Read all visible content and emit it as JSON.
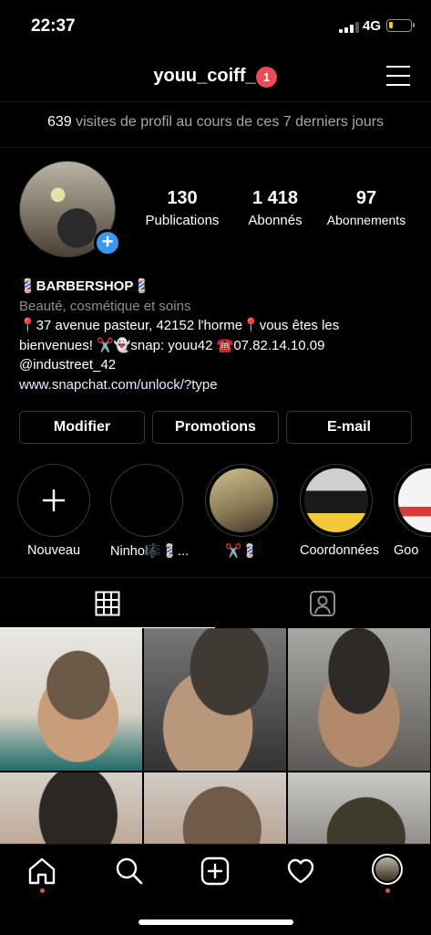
{
  "status_bar": {
    "time": "22:37",
    "network": "4G"
  },
  "header": {
    "username": "youu_coiff_",
    "notification_count": "1"
  },
  "visits": {
    "count": "639",
    "text": "visites de profil au cours de ces 7 derniers jours"
  },
  "stats": [
    {
      "value": "130",
      "label": "Publications"
    },
    {
      "value": "1 418",
      "label": "Abonnés"
    },
    {
      "value": "97",
      "label": "Abonnements"
    }
  ],
  "bio": {
    "name": "💈BARBERSHOP💈",
    "category": "Beauté, cosmétique et soins",
    "line1": "📍37 avenue pasteur, 42152 l'horme📍vous êtes les",
    "line2": "bienvenues! ✂️👻snap: youu42 ☎️07.82.14.10.09",
    "line3": "@industreet_42",
    "link": "www.snapchat.com/unlock/?type"
  },
  "buttons": {
    "edit": "Modifier",
    "promotions": "Promotions",
    "email": "E-mail"
  },
  "highlights": [
    {
      "label": "Nouveau"
    },
    {
      "label": "Ninho🎼💈..."
    },
    {
      "label": "✂️💈"
    },
    {
      "label": "Coordonnées"
    },
    {
      "label": "Goo"
    }
  ],
  "colors": {
    "accent_blue": "#3897f0",
    "badge_red": "#ed4956"
  },
  "icons": [
    "grid-icon",
    "tagged-icon",
    "home-icon",
    "search-icon",
    "add-post-icon",
    "heart-icon",
    "profile-avatar"
  ]
}
